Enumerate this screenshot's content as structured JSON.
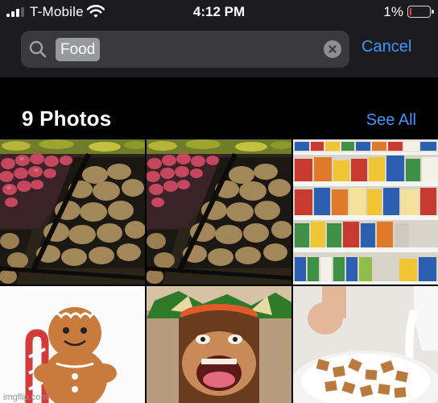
{
  "status_bar": {
    "carrier": "T-Mobile",
    "time": "4:12 PM",
    "battery_percent": "1%",
    "battery_level": 0.01,
    "battery_color": "#ff3b30",
    "signal_bars_active": 3,
    "signal_bars_total": 4
  },
  "search": {
    "token": "Food",
    "cancel_label": "Cancel",
    "icons": {
      "search": "search-icon",
      "clear": "clear-icon"
    }
  },
  "section": {
    "title": "9 Photos",
    "see_all_label": "See All"
  },
  "photos": [
    {
      "subject": "potatoes-and-red-potatoes-in-crates"
    },
    {
      "subject": "potatoes-and-red-potatoes-in-crates"
    },
    {
      "subject": "cereal-boxes-on-shelves"
    },
    {
      "subject": "gingerbread-man-plush-with-candy-cane"
    },
    {
      "subject": "bowser-and-donkey-kong-meme"
    },
    {
      "subject": "cereal-with-milk-pouring"
    }
  ],
  "watermark": "imgflip.com",
  "colors": {
    "accent": "#3e95ff",
    "header_bg": "#1c1c1e",
    "search_field_bg": "#3a3a3c",
    "token_bg": "#98989f"
  }
}
